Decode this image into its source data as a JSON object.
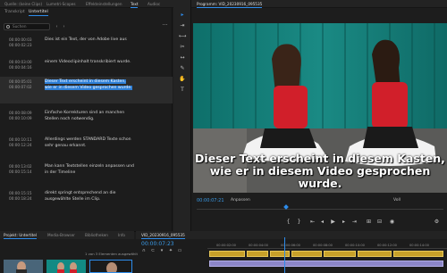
{
  "panel_tabs": [
    "Quelle: (keine Clips)",
    "Lumetri-Scopes",
    "Effekteinstellungen",
    "Text",
    "Audioc"
  ],
  "text_panel": {
    "subtabs": [
      "Transkript",
      "Untertitel"
    ],
    "search_placeholder": "Suchen",
    "more_label": "···"
  },
  "captions": [
    {
      "in": "00:00:00:03",
      "out": "00:00:02:23",
      "text": "Dies ist ein Text, der von Adobe live aus",
      "selected": false
    },
    {
      "in": "00:00:03:00",
      "out": "00:00:04:16",
      "text": "einem Videoclipinhalt transkribiert wurde.",
      "selected": false
    },
    {
      "in": "00:00:05:01",
      "out": "00:00:07:02",
      "text": "Dieser Text erscheint in diesem Kasten, wie er in diesem Video gesprochen wurde.",
      "selected": true
    },
    {
      "in": "00:00:08:09",
      "out": "00:00:10:09",
      "text": "Einfache Korrekturen sind an manchen Stellen noch notwendig.",
      "selected": false
    },
    {
      "in": "00:00:10:11",
      "out": "00:00:12:24",
      "text": "Allerdings werden STANDARD Texte schon sehr genau erkannt.",
      "selected": false
    },
    {
      "in": "00:00:13:02",
      "out": "00:00:15:14",
      "text": "Man kann Textstellen einzeln anpassen und in der Timeline",
      "selected": false
    },
    {
      "in": "00:00:15:15",
      "out": "00:00:18:24",
      "text": "direkt springt entsprechend an die ausgewählte Stelle im Clip.",
      "selected": false
    }
  ],
  "monitor": {
    "title": "Programm: VID_20230916_095535",
    "subtitle_line1": "Dieser Text erscheint in diesem Kasten,",
    "subtitle_line2": "wie er in diesem Video gesprochen wurde.",
    "timecode": "00:00:07:21",
    "fit": "Anpassen",
    "quality": "Voll"
  },
  "project": {
    "tabs": [
      "Projekt: Untertitel",
      "Media-Browser",
      "Bibliotheken",
      "Info"
    ],
    "count": "1 von 3 Elementen ausgewählt"
  },
  "timeline": {
    "title": "VID_20230916_095535",
    "timecode": "00:00:07:23",
    "ruler": [
      "00:00:02:00",
      "00:00:04:00",
      "00:00:06:00",
      "00:00:08:00",
      "00:00:10:00",
      "00:00:12:00",
      "00:00:14:00"
    ]
  },
  "tools": [
    "selection-tool",
    "track-select-tool",
    "ripple-edit-tool",
    "razor-tool",
    "slip-tool",
    "pen-tool",
    "hand-tool",
    "type-tool"
  ],
  "colors": {
    "accent": "#2d8ceb",
    "caption_clip": "#c7a029",
    "video_clip": "#8c86c8"
  }
}
